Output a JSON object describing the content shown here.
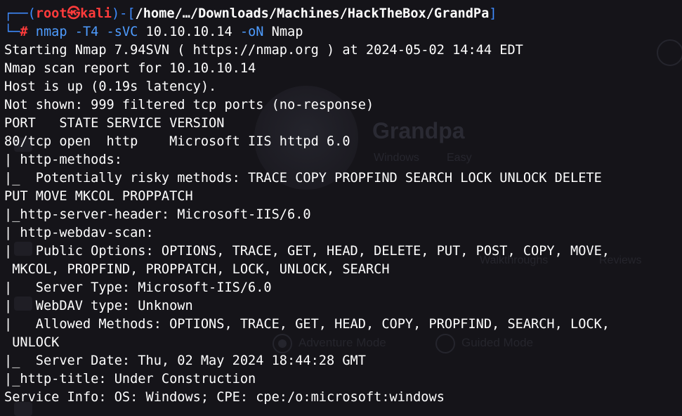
{
  "prompt": {
    "open_bracket": "┌──(",
    "user": "root",
    "at_symbol": "㉿",
    "host": "kali",
    "middle": ")-[",
    "path": "/home/…/Downloads/Machines/HackTheBox/GrandPa",
    "close_bracket": "]",
    "second_prefix": "└─",
    "hash": "#",
    "command": "nmap",
    "args": [
      " -T4",
      " -sVC",
      " 10.10.10.14",
      " -oN",
      " Nmap"
    ]
  },
  "output_lines": [
    "Starting Nmap 7.94SVN ( https://nmap.org ) at 2024-05-02 14:44 EDT",
    "Nmap scan report for 10.10.10.14",
    "Host is up (0.19s latency).",
    "Not shown: 999 filtered tcp ports (no-response)",
    "PORT   STATE SERVICE VERSION",
    "80/tcp open  http    Microsoft IIS httpd 6.0",
    "| http-methods:",
    "|_  Potentially risky methods: TRACE COPY PROPFIND SEARCH LOCK UNLOCK DELETE",
    "PUT MOVE MKCOL PROPPATCH",
    "|_http-server-header: Microsoft-IIS/6.0",
    "| http-webdav-scan:",
    "|   Public Options: OPTIONS, TRACE, GET, HEAD, DELETE, PUT, POST, COPY, MOVE,",
    " MKCOL, PROPFIND, PROPPATCH, LOCK, UNLOCK, SEARCH",
    "|   Server Type: Microsoft-IIS/6.0",
    "|   WebDAV type: Unknown",
    "|   Allowed Methods: OPTIONS, TRACE, GET, HEAD, COPY, PROPFIND, SEARCH, LOCK,",
    " UNLOCK",
    "|_  Server Date: Thu, 02 May 2024 18:44:28 GMT",
    "|_http-title: Under Construction",
    "Service Info: OS: Windows; CPE: cpe:/o:microsoft:windows"
  ],
  "background_window": {
    "machine_name": "Grandpa",
    "os": "Windows",
    "difficulty": "Easy",
    "tabs": [
      "Walkthroughs",
      "Reviews"
    ],
    "modes": [
      "Adventure Mode",
      "Guided Mode"
    ]
  },
  "colors": {
    "background": "#151419",
    "prompt_frame": "#3f8cff",
    "prompt_user": "#ff3b3b",
    "command": "#4e9cff",
    "text": "#ffffff"
  }
}
